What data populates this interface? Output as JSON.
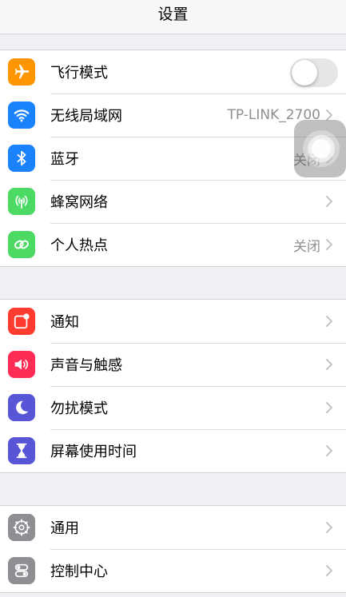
{
  "navbar": {
    "title": "设置"
  },
  "groups": [
    {
      "rows": [
        {
          "label": "飞行模式",
          "icon": "airplane-icon",
          "color": "#ff9500",
          "toggle": false
        },
        {
          "label": "无线局域网",
          "icon": "wifi-icon",
          "color": "#1a82fb",
          "value": "TP-LINK_2700"
        },
        {
          "label": "蓝牙",
          "icon": "bluetooth-icon",
          "color": "#1a82fb",
          "value": "关闭"
        },
        {
          "label": "蜂窝网络",
          "icon": "cellular-icon",
          "color": "#4cd964"
        },
        {
          "label": "个人热点",
          "icon": "hotspot-icon",
          "color": "#4cd964",
          "value": "关闭"
        }
      ]
    },
    {
      "rows": [
        {
          "label": "通知",
          "icon": "notifications-icon",
          "color": "#ff3b30"
        },
        {
          "label": "声音与触感",
          "icon": "sound-icon",
          "color": "#ff2d55"
        },
        {
          "label": "勿扰模式",
          "icon": "moon-icon",
          "color": "#5856d6"
        },
        {
          "label": "屏幕使用时间",
          "icon": "hourglass-icon",
          "color": "#5856d6"
        }
      ]
    },
    {
      "rows": [
        {
          "label": "通用",
          "icon": "gear-icon",
          "color": "#8e8e93"
        },
        {
          "label": "控制中心",
          "icon": "toggles-icon",
          "color": "#8e8e93"
        }
      ]
    }
  ]
}
